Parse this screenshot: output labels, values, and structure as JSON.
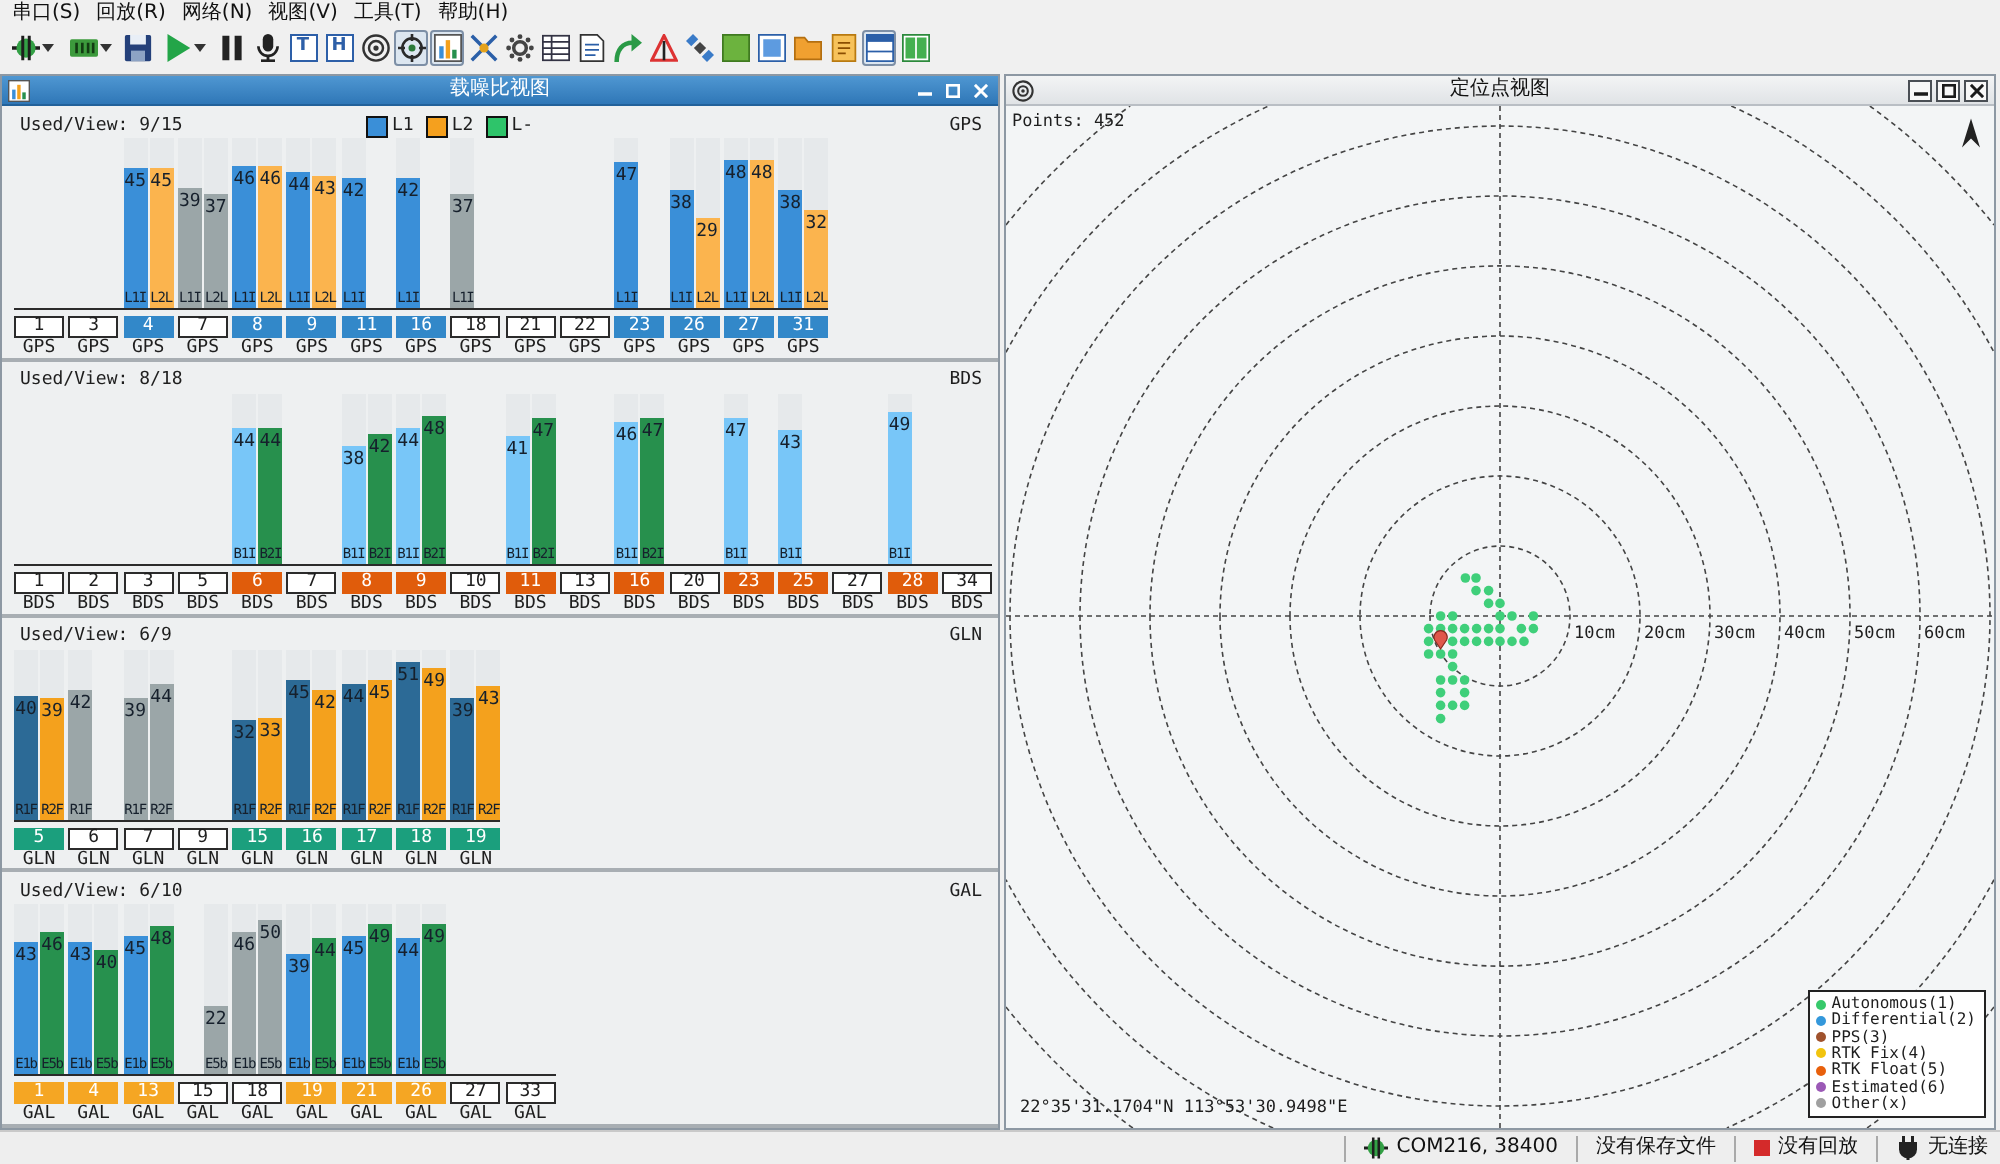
{
  "menu": [
    {
      "label": "串口(S)"
    },
    {
      "label": "回放(R)"
    },
    {
      "label": "网络(N)"
    },
    {
      "label": "视图(V)"
    },
    {
      "label": "工具(T)"
    },
    {
      "label": "帮助(H)"
    }
  ],
  "toolbar": [
    {
      "kind": "connect",
      "dropdown": true,
      "pressed": false
    },
    {
      "kind": "port",
      "dropdown": true,
      "pressed": false
    },
    {
      "kind": "save",
      "dropdown": false,
      "pressed": false
    },
    {
      "kind": "play",
      "dropdown": true,
      "pressed": false
    },
    {
      "kind": "pause",
      "dropdown": false,
      "pressed": false
    },
    {
      "kind": "microphone",
      "dropdown": false,
      "pressed": false
    },
    {
      "kind": "letter",
      "label": "T",
      "dropdown": false,
      "pressed": false
    },
    {
      "kind": "letter",
      "label": "H",
      "dropdown": false,
      "pressed": false
    },
    {
      "kind": "target",
      "dropdown": false,
      "pressed": false
    },
    {
      "kind": "crosshair",
      "dropdown": false,
      "pressed": true
    },
    {
      "kind": "chart",
      "dropdown": false,
      "pressed": true
    },
    {
      "kind": "cross",
      "dropdown": false,
      "pressed": false
    },
    {
      "kind": "gear",
      "dropdown": false,
      "pressed": false
    },
    {
      "kind": "table",
      "dropdown": false,
      "pressed": false
    },
    {
      "kind": "document",
      "dropdown": false,
      "pressed": false
    },
    {
      "kind": "arrow",
      "dropdown": false,
      "pressed": false
    },
    {
      "kind": "triangle",
      "dropdown": false,
      "pressed": false
    },
    {
      "kind": "satellite",
      "dropdown": false,
      "pressed": false
    },
    {
      "kind": "square",
      "dropdown": false,
      "pressed": false
    },
    {
      "kind": "window",
      "dropdown": false,
      "pressed": false
    },
    {
      "kind": "folder",
      "dropdown": false,
      "pressed": false
    },
    {
      "kind": "notes",
      "dropdown": false,
      "pressed": false
    },
    {
      "kind": "layout",
      "dropdown": false,
      "pressed": true
    },
    {
      "kind": "panels",
      "dropdown": false,
      "pressed": false
    }
  ],
  "cn0_panel": {
    "title": "载噪比视图",
    "active": true,
    "sections": [
      {
        "summary": "Used/View: 9/15",
        "system": "GPS",
        "color": "#3288c9",
        "legend": [
          {
            "label": "L1",
            "color": "#3a8fd8"
          },
          {
            "label": "L2",
            "color": "#f5a01e"
          },
          {
            "label": "L-",
            "color": "#2ec46a"
          }
        ],
        "satellites": [
          {
            "prn": "1",
            "used": false,
            "system": "GPS"
          },
          {
            "prn": "3",
            "used": false,
            "system": "GPS"
          },
          {
            "prn": "4",
            "used": true,
            "system": "GPS",
            "bars": [
              {
                "kind": "primary",
                "value": "45",
                "signal": "L1I",
                "level": 0.818,
                "color": "#3a8fd8"
              },
              {
                "kind": "secondary",
                "value": "45",
                "signal": "L2L",
                "level": 0.818,
                "color": "#fbb44e"
              }
            ]
          },
          {
            "prn": "7",
            "used": false,
            "system": "GPS",
            "bars": [
              {
                "kind": "primary",
                "value": "39",
                "signal": "L1I",
                "level": 0.709,
                "color": "#9ba6a8"
              },
              {
                "kind": "secondary",
                "value": "37",
                "signal": "L2L",
                "level": 0.673,
                "color": "#9ba6a8"
              }
            ]
          },
          {
            "prn": "8",
            "used": true,
            "system": "GPS",
            "bars": [
              {
                "kind": "primary",
                "value": "46",
                "signal": "L1I",
                "level": 0.836,
                "color": "#3a8fd8"
              },
              {
                "kind": "secondary",
                "value": "46",
                "signal": "L2L",
                "level": 0.836,
                "color": "#fbb44e"
              }
            ]
          },
          {
            "prn": "9",
            "used": true,
            "system": "GPS",
            "bars": [
              {
                "kind": "primary",
                "value": "44",
                "signal": "L1I",
                "level": 0.8,
                "color": "#3a8fd8"
              },
              {
                "kind": "secondary",
                "value": "43",
                "signal": "L2L",
                "level": 0.782,
                "color": "#fbb44e"
              }
            ]
          },
          {
            "prn": "11",
            "used": true,
            "system": "GPS",
            "bars": [
              {
                "kind": "primary",
                "value": "42",
                "signal": "L1I",
                "level": 0.764,
                "color": "#3a8fd8"
              }
            ]
          },
          {
            "prn": "16",
            "used": true,
            "system": "GPS",
            "bars": [
              {
                "kind": "primary",
                "value": "42",
                "signal": "L1I",
                "level": 0.764,
                "color": "#3a8fd8"
              }
            ]
          },
          {
            "prn": "18",
            "used": false,
            "system": "GPS",
            "bars": [
              {
                "kind": "primary",
                "value": "37",
                "signal": "L1I",
                "level": 0.673,
                "color": "#9ba6a8"
              }
            ]
          },
          {
            "prn": "21",
            "used": false,
            "system": "GPS"
          },
          {
            "prn": "22",
            "used": false,
            "system": "GPS"
          },
          {
            "prn": "23",
            "used": true,
            "system": "GPS",
            "bars": [
              {
                "kind": "primary",
                "value": "47",
                "signal": "L1I",
                "level": 0.855,
                "color": "#3a8fd8"
              }
            ]
          },
          {
            "prn": "26",
            "used": true,
            "system": "GPS",
            "bars": [
              {
                "kind": "primary",
                "value": "38",
                "signal": "L1I",
                "level": 0.691,
                "color": "#3a8fd8"
              },
              {
                "kind": "secondary",
                "value": "29",
                "signal": "L2L",
                "level": 0.527,
                "color": "#fbb44e"
              }
            ]
          },
          {
            "prn": "27",
            "used": true,
            "system": "GPS",
            "bars": [
              {
                "kind": "primary",
                "value": "48",
                "signal": "L1I",
                "level": 0.873,
                "color": "#3a8fd8"
              },
              {
                "kind": "secondary",
                "value": "48",
                "signal": "L2L",
                "level": 0.873,
                "color": "#fbb44e"
              }
            ]
          },
          {
            "prn": "31",
            "used": true,
            "system": "GPS",
            "bars": [
              {
                "kind": "primary",
                "value": "38",
                "signal": "L1I",
                "level": 0.691,
                "color": "#3a8fd8"
              },
              {
                "kind": "secondary",
                "value": "32",
                "signal": "L2L",
                "level": 0.582,
                "color": "#fbb44e"
              }
            ]
          }
        ]
      },
      {
        "summary": "Used/View: 8/18",
        "system": "BDS",
        "color": "#e05c0b",
        "satellites": [
          {
            "prn": "1",
            "used": false,
            "system": "BDS"
          },
          {
            "prn": "2",
            "used": false,
            "system": "BDS"
          },
          {
            "prn": "3",
            "used": false,
            "system": "BDS"
          },
          {
            "prn": "5",
            "used": false,
            "system": "BDS"
          },
          {
            "prn": "6",
            "used": true,
            "system": "BDS",
            "bars": [
              {
                "kind": "primary",
                "value": "44",
                "signal": "B1I",
                "level": 0.8,
                "color": "#78c6f8"
              },
              {
                "kind": "secondary",
                "value": "44",
                "signal": "B2I",
                "level": 0.8,
                "color": "#27904d"
              }
            ]
          },
          {
            "prn": "7",
            "used": false,
            "system": "BDS"
          },
          {
            "prn": "8",
            "used": true,
            "system": "BDS",
            "bars": [
              {
                "kind": "primary",
                "value": "38",
                "signal": "B1I",
                "level": 0.691,
                "color": "#78c6f8"
              },
              {
                "kind": "secondary",
                "value": "42",
                "signal": "B2I",
                "level": 0.764,
                "color": "#27904d"
              }
            ]
          },
          {
            "prn": "9",
            "used": true,
            "system": "BDS",
            "bars": [
              {
                "kind": "primary",
                "value": "44",
                "signal": "B1I",
                "level": 0.8,
                "color": "#78c6f8"
              },
              {
                "kind": "secondary",
                "value": "48",
                "signal": "B2I",
                "level": 0.873,
                "color": "#27904d"
              }
            ]
          },
          {
            "prn": "10",
            "used": false,
            "system": "BDS"
          },
          {
            "prn": "11",
            "used": true,
            "system": "BDS",
            "bars": [
              {
                "kind": "primary",
                "value": "41",
                "signal": "B1I",
                "level": 0.745,
                "color": "#78c6f8"
              },
              {
                "kind": "secondary",
                "value": "47",
                "signal": "B2I",
                "level": 0.855,
                "color": "#27904d"
              }
            ]
          },
          {
            "prn": "13",
            "used": false,
            "system": "BDS"
          },
          {
            "prn": "16",
            "used": true,
            "system": "BDS",
            "bars": [
              {
                "kind": "primary",
                "value": "46",
                "signal": "B1I",
                "level": 0.836,
                "color": "#78c6f8"
              },
              {
                "kind": "secondary",
                "value": "47",
                "signal": "B2I",
                "level": 0.855,
                "color": "#27904d"
              }
            ]
          },
          {
            "prn": "20",
            "used": false,
            "system": "BDS"
          },
          {
            "prn": "23",
            "used": true,
            "system": "BDS",
            "bars": [
              {
                "kind": "primary",
                "value": "47",
                "signal": "B1I",
                "level": 0.855,
                "color": "#78c6f8"
              }
            ]
          },
          {
            "prn": "25",
            "used": true,
            "system": "BDS",
            "bars": [
              {
                "kind": "primary",
                "value": "43",
                "signal": "B1I",
                "level": 0.782,
                "color": "#78c6f8"
              }
            ]
          },
          {
            "prn": "27",
            "used": false,
            "system": "BDS"
          },
          {
            "prn": "28",
            "used": true,
            "system": "BDS",
            "bars": [
              {
                "kind": "primary",
                "value": "49",
                "signal": "B1I",
                "level": 0.891,
                "color": "#78c6f8"
              }
            ]
          },
          {
            "prn": "34",
            "used": false,
            "system": "BDS"
          }
        ]
      },
      {
        "summary": "Used/View: 6/9",
        "system": "GLN",
        "color": "#1b9f7d",
        "satellites": [
          {
            "prn": "5",
            "used": true,
            "system": "GLN",
            "bars": [
              {
                "kind": "primary",
                "value": "40",
                "signal": "R1F",
                "level": 0.727,
                "color": "#2c6a96"
              },
              {
                "kind": "secondary",
                "value": "39",
                "signal": "R2F",
                "level": 0.709,
                "color": "#f4a11d"
              }
            ]
          },
          {
            "prn": "6",
            "used": false,
            "system": "GLN",
            "bars": [
              {
                "kind": "primary",
                "value": "42",
                "signal": "R1F",
                "level": 0.764,
                "color": "#9ba6a8"
              }
            ]
          },
          {
            "prn": "7",
            "used": false,
            "system": "GLN",
            "bars": [
              {
                "kind": "primary",
                "value": "39",
                "signal": "R1F",
                "level": 0.709,
                "color": "#9ba6a8"
              },
              {
                "kind": "secondary",
                "value": "44",
                "signal": "R2F",
                "level": 0.8,
                "color": "#9ba6a8"
              }
            ]
          },
          {
            "prn": "9",
            "used": false,
            "system": "GLN"
          },
          {
            "prn": "15",
            "used": true,
            "system": "GLN",
            "bars": [
              {
                "kind": "primary",
                "value": "32",
                "signal": "R1F",
                "level": 0.582,
                "color": "#2c6a96"
              },
              {
                "kind": "secondary",
                "value": "33",
                "signal": "R2F",
                "level": 0.6,
                "color": "#f4a11d"
              }
            ]
          },
          {
            "prn": "16",
            "used": true,
            "system": "GLN",
            "bars": [
              {
                "kind": "primary",
                "value": "45",
                "signal": "R1F",
                "level": 0.818,
                "color": "#2c6a96"
              },
              {
                "kind": "secondary",
                "value": "42",
                "signal": "R2F",
                "level": 0.764,
                "color": "#f4a11d"
              }
            ]
          },
          {
            "prn": "17",
            "used": true,
            "system": "GLN",
            "bars": [
              {
                "kind": "primary",
                "value": "44",
                "signal": "R1F",
                "level": 0.8,
                "color": "#2c6a96"
              },
              {
                "kind": "secondary",
                "value": "45",
                "signal": "R2F",
                "level": 0.818,
                "color": "#f4a11d"
              }
            ]
          },
          {
            "prn": "18",
            "used": true,
            "system": "GLN",
            "bars": [
              {
                "kind": "primary",
                "value": "51",
                "signal": "R1F",
                "level": 0.927,
                "color": "#2c6a96"
              },
              {
                "kind": "secondary",
                "value": "49",
                "signal": "R2F",
                "level": 0.891,
                "color": "#f4a11d"
              }
            ]
          },
          {
            "prn": "19",
            "used": true,
            "system": "GLN",
            "bars": [
              {
                "kind": "primary",
                "value": "39",
                "signal": "R1F",
                "level": 0.709,
                "color": "#2c6a96"
              },
              {
                "kind": "secondary",
                "value": "43",
                "signal": "R2F",
                "level": 0.782,
                "color": "#f4a11d"
              }
            ]
          }
        ]
      },
      {
        "summary": "Used/View: 6/10",
        "system": "GAL",
        "color": "#f5a623",
        "satellites": [
          {
            "prn": "1",
            "used": true,
            "system": "GAL",
            "bars": [
              {
                "kind": "primary",
                "value": "43",
                "signal": "E1b",
                "level": 0.782,
                "color": "#3a90d9"
              },
              {
                "kind": "secondary",
                "value": "46",
                "signal": "E5b",
                "level": 0.836,
                "color": "#27914e"
              }
            ]
          },
          {
            "prn": "4",
            "used": true,
            "system": "GAL",
            "bars": [
              {
                "kind": "primary",
                "value": "43",
                "signal": "E1b",
                "level": 0.782,
                "color": "#3a90d9"
              },
              {
                "kind": "secondary",
                "value": "40",
                "signal": "E5b",
                "level": 0.727,
                "color": "#27914e"
              }
            ]
          },
          {
            "prn": "13",
            "used": true,
            "system": "GAL",
            "bars": [
              {
                "kind": "primary",
                "value": "45",
                "signal": "E1b",
                "level": 0.818,
                "color": "#3a90d9"
              },
              {
                "kind": "secondary",
                "value": "48",
                "signal": "E5b",
                "level": 0.873,
                "color": "#27914e"
              }
            ]
          },
          {
            "prn": "15",
            "used": false,
            "system": "GAL",
            "bars": [
              {
                "kind": "secondary",
                "value": "22",
                "signal": "E5b",
                "level": 0.4,
                "color": "#9ba6a8"
              }
            ]
          },
          {
            "prn": "18",
            "used": false,
            "system": "GAL",
            "bars": [
              {
                "kind": "primary",
                "value": "46",
                "signal": "E1b",
                "level": 0.836,
                "color": "#9ba6a8"
              },
              {
                "kind": "secondary",
                "value": "50",
                "signal": "E5b",
                "level": 0.909,
                "color": "#9ba6a8"
              }
            ]
          },
          {
            "prn": "19",
            "used": true,
            "system": "GAL",
            "bars": [
              {
                "kind": "primary",
                "value": "39",
                "signal": "E1b",
                "level": 0.709,
                "color": "#3a90d9"
              },
              {
                "kind": "secondary",
                "value": "44",
                "signal": "E5b",
                "level": 0.8,
                "color": "#27914e"
              }
            ]
          },
          {
            "prn": "21",
            "used": true,
            "system": "GAL",
            "bars": [
              {
                "kind": "primary",
                "value": "45",
                "signal": "E1b",
                "level": 0.818,
                "color": "#3a90d9"
              },
              {
                "kind": "secondary",
                "value": "49",
                "signal": "E5b",
                "level": 0.891,
                "color": "#27914e"
              }
            ]
          },
          {
            "prn": "26",
            "used": true,
            "system": "GAL",
            "bars": [
              {
                "kind": "primary",
                "value": "44",
                "signal": "E1b",
                "level": 0.8,
                "color": "#3a90d9"
              },
              {
                "kind": "secondary",
                "value": "49",
                "signal": "E5b",
                "level": 0.891,
                "color": "#27914e"
              }
            ]
          },
          {
            "prn": "27",
            "used": false,
            "system": "GAL"
          },
          {
            "prn": "33",
            "used": false,
            "system": "GAL"
          }
        ]
      }
    ]
  },
  "position_panel": {
    "title": "定位点视图",
    "active": false,
    "points": "Points: 452",
    "ring_labels": [
      "10cm",
      "20cm",
      "30cm",
      "40cm",
      "50cm",
      "60cm"
    ],
    "coordinates": "22°35'31.1704\"N 113°53'30.9498\"E",
    "legend": [
      {
        "label": "Autonomous(1)",
        "color": "#37c96b"
      },
      {
        "label": "Differential(2)",
        "color": "#3498db"
      },
      {
        "label": "PPS(3)",
        "color": "#a0522d"
      },
      {
        "label": "RTK Fix(4)",
        "color": "#f1c40f"
      },
      {
        "label": "RTK Float(5)",
        "color": "#e8600c"
      },
      {
        "label": "Estimated(6)",
        "color": "#9b59b6"
      },
      {
        "label": "Other(x)",
        "color": "#a0a0a0"
      }
    ]
  },
  "status_bar": [
    {
      "kind": "port",
      "text": "COM216, 38400"
    },
    {
      "kind": "file",
      "text": "没有保存文件"
    },
    {
      "kind": "playback",
      "text": "没有回放"
    },
    {
      "kind": "connection",
      "text": "无连接"
    }
  ]
}
